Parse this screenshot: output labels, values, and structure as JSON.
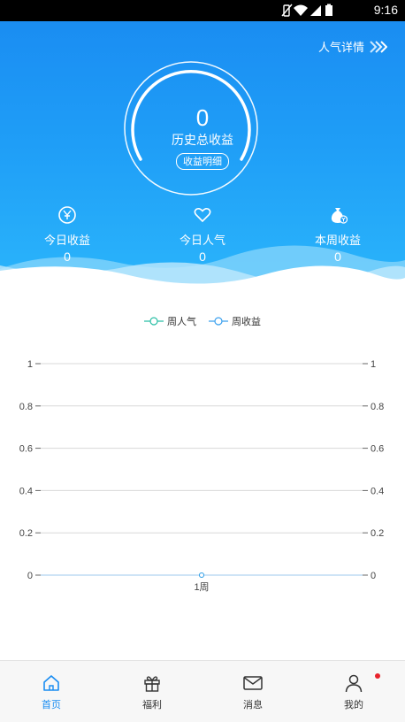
{
  "status_bar": {
    "time": "9:16"
  },
  "header": {
    "popularity_link": "人气详情",
    "total_earnings_value": "0",
    "total_earnings_label": "历史总收益",
    "detail_button": "收益明细",
    "stats": [
      {
        "icon": "yen-circle-icon",
        "label": "今日收益",
        "value": "0"
      },
      {
        "icon": "heart-icon",
        "label": "今日人气",
        "value": "0"
      },
      {
        "icon": "money-bag-icon",
        "label": "本周收益",
        "value": "0"
      }
    ]
  },
  "chart_data": {
    "type": "line",
    "categories": [
      "1周"
    ],
    "series": [
      {
        "name": "周人气",
        "values": [
          0
        ],
        "color": "#2bbfa6"
      },
      {
        "name": "周收益",
        "values": [
          0
        ],
        "color": "#3aa0ee"
      }
    ],
    "ylim": [
      0,
      1
    ],
    "left_ticks": [
      "1",
      "0.8",
      "0.6",
      "0.4",
      "0.2",
      "0"
    ],
    "right_ticks": [
      "1",
      "0.8",
      "0.6",
      "0.4",
      "0.2",
      "0"
    ],
    "grid": true,
    "legend": "top-center"
  },
  "tabbar": {
    "tabs": [
      {
        "label": "首页",
        "icon": "home-icon",
        "active": true
      },
      {
        "label": "福利",
        "icon": "gift-icon",
        "active": false
      },
      {
        "label": "消息",
        "icon": "mail-icon",
        "active": false
      },
      {
        "label": "我的",
        "icon": "user-icon",
        "active": false
      }
    ]
  },
  "colors": {
    "primary": "#1a8df2",
    "badge": "#e8222b"
  }
}
